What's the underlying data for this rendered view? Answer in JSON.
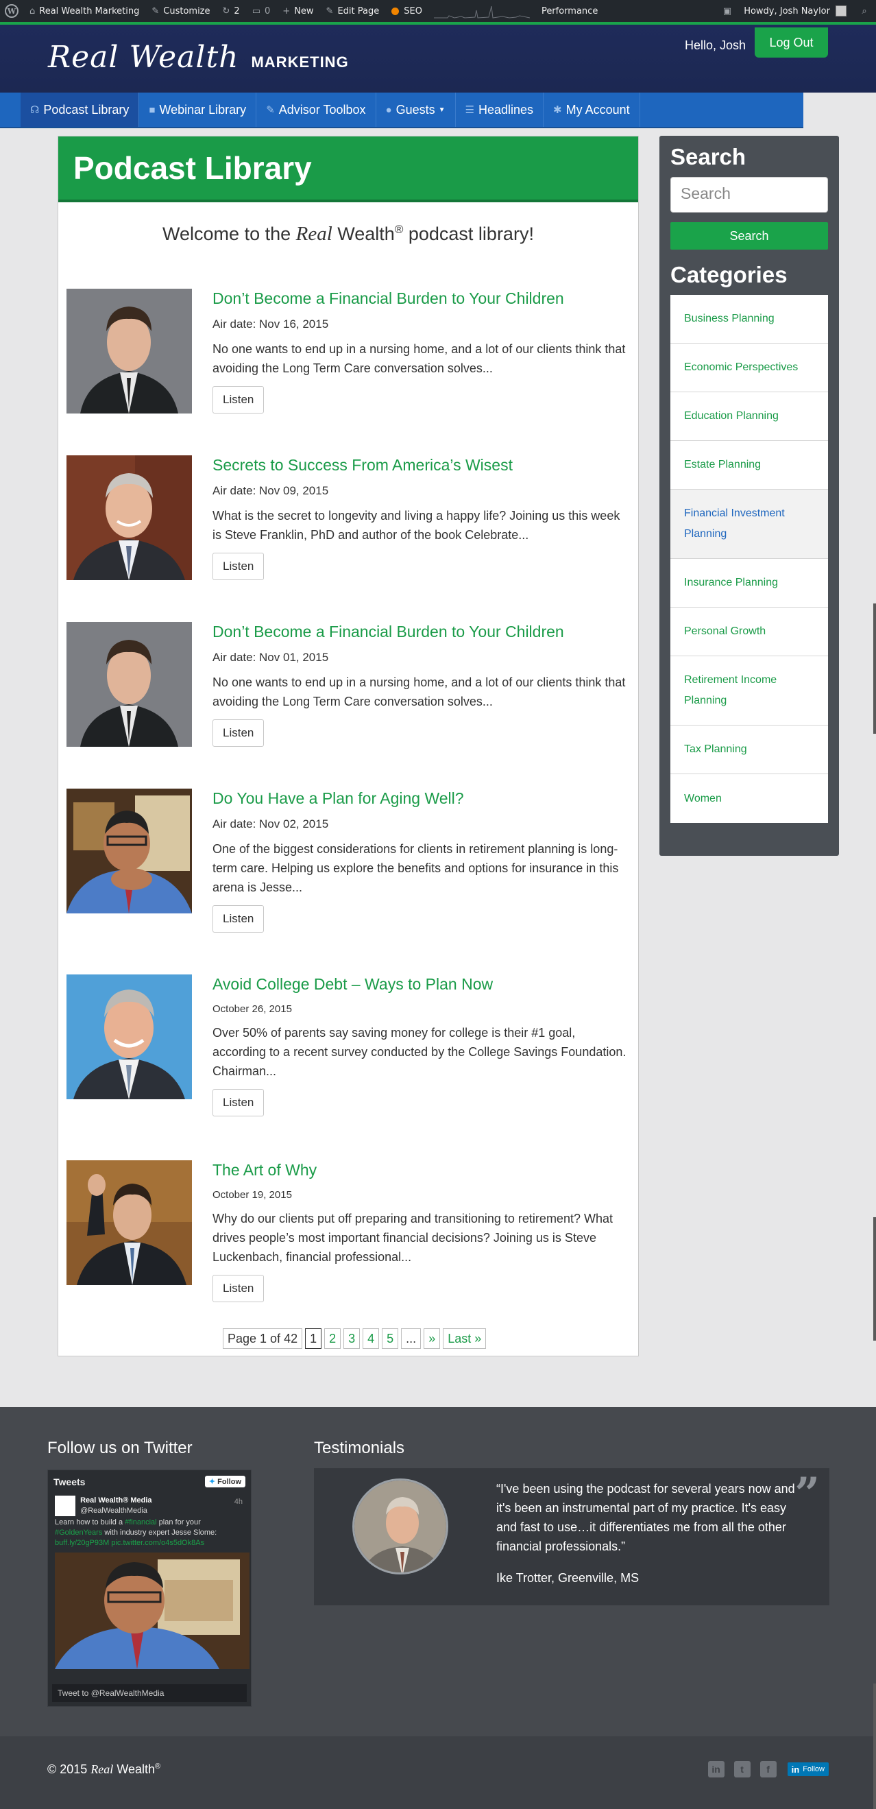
{
  "adminbar": {
    "site_name": "Real Wealth Marketing",
    "customize": "Customize",
    "updates_count": "2",
    "comments_count": "0",
    "new_label": "New",
    "edit_page": "Edit Page",
    "seo": "SEO",
    "performance": "Performance",
    "howdy": "Howdy, Josh Naylor"
  },
  "header": {
    "logo_script": "Real Wealth",
    "logo_mark": "MARKETING",
    "hello": "Hello, Josh",
    "logout": "Log Out"
  },
  "nav": {
    "items": [
      {
        "label": "Podcast Library",
        "icon": "headphones-icon"
      },
      {
        "label": "Webinar Library",
        "icon": "video-icon"
      },
      {
        "label": "Advisor Toolbox",
        "icon": "wrench-icon"
      },
      {
        "label": "Guests",
        "icon": "user-icon"
      },
      {
        "label": "Headlines",
        "icon": "list-icon"
      },
      {
        "label": "My Account",
        "icon": "gear-icon"
      }
    ]
  },
  "main": {
    "title": "Podcast Library",
    "welcome_pre": "Welcome to the ",
    "welcome_brand_italic": "Real",
    "welcome_brand": " Wealth",
    "welcome_reg": "®",
    "welcome_post": " podcast library!",
    "listen_label": "Listen",
    "posts": [
      {
        "title": "Don’t Become a Financial Burden to Your Children",
        "date": "Air date: Nov 16, 2015",
        "excerpt": "No one wants to end up in a nursing home, and a lot of our clients think that avoiding the Long Term Care conversation solves..."
      },
      {
        "title": "Secrets to Success From America’s Wisest",
        "date": "Air date: Nov 09, 2015",
        "excerpt": "What is the secret to longevity and living a happy life? Joining us this week is Steve Franklin, PhD and author of the book Celebrate..."
      },
      {
        "title": "Don’t Become a Financial Burden to Your Children",
        "date": "Air date: Nov 01, 2015",
        "excerpt": "No one wants to end up in a nursing home, and a lot of our clients think that avoiding the Long Term Care conversation solves..."
      },
      {
        "title": "Do You Have a Plan for Aging Well?",
        "date": "Air date: Nov 02, 2015",
        "excerpt": "One of the biggest considerations for clients in retirement planning is long-term care. Helping us explore the benefits and options for insurance in this arena is Jesse..."
      },
      {
        "title": "Avoid College Debt – Ways to Plan Now",
        "date": "October 26, 2015",
        "excerpt": "Over 50% of parents say saving money for college is their #1 goal, according to a recent survey conducted by the College Savings Foundation. Chairman..."
      },
      {
        "title": "The Art of Why",
        "date": "October 19, 2015",
        "excerpt": "Why do our clients put off preparing and transitioning to retirement? What drives people’s most important financial decisions? Joining us is Steve Luckenbach, financial professional..."
      }
    ],
    "pager": {
      "info": "Page 1 of 42",
      "pages": [
        "1",
        "2",
        "3",
        "4",
        "5"
      ],
      "ellipsis": "...",
      "next": "»",
      "last": "Last »"
    }
  },
  "sidebar": {
    "search_title": "Search",
    "search_placeholder": "Search",
    "search_button": "Search",
    "categories_title": "Categories",
    "categories": [
      "Business Planning",
      "Economic Perspectives",
      "Education Planning",
      "Estate Planning",
      "Financial Investment Planning",
      "Insurance Planning",
      "Personal Growth",
      "Retirement Income Planning",
      "Tax Planning",
      "Women"
    ]
  },
  "footer": {
    "twitter_title": "Follow us on Twitter",
    "tweets_label": "Tweets",
    "follow_label": "Follow",
    "tweet_name": "Real Wealth® Media",
    "tweet_handle": "@RealWealthMedia",
    "tweet_time": "4h",
    "tweet_text_1": "Learn how to build a ",
    "tweet_hashtag_1": "#financial",
    "tweet_text_2": " plan for your ",
    "tweet_hashtag_2": "#GoldenYears",
    "tweet_text_3": " with industry expert Jesse Slome: ",
    "tweet_links": "buff.ly/20gP93M pic.twitter.com/o4s5dOk8As",
    "tweet_to": "Tweet to @RealWealthMedia",
    "testimonials_title": "Testimonials",
    "quote": "“I've been using the podcast for several years now and it's been an instrumental part of my practice. It's easy and fast to use…it differentiates me from all the other financial professionals.”",
    "quote_by": "Ike Trotter, Greenville, MS",
    "copyright_pre": "© 2015 ",
    "copyright_italic": "Real",
    "copyright_brand": " Wealth",
    "copyright_reg": "®",
    "linkedin_follow": "Follow",
    "linkedin_in": "in"
  },
  "colors": {
    "brand_green": "#1aa34a",
    "nav_blue": "#1e66be",
    "header_navy": "#1f2b5a"
  }
}
